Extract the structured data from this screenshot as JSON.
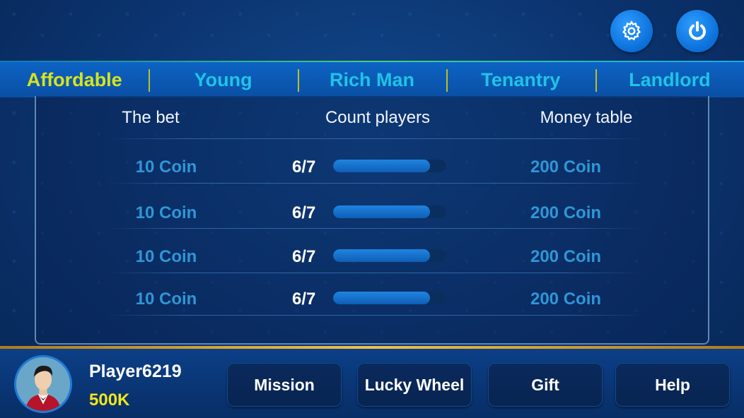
{
  "header": {
    "settings_icon": "gear-icon",
    "power_icon": "power-icon"
  },
  "tabs": [
    {
      "label": "Affordable",
      "active": true
    },
    {
      "label": "Young",
      "active": false
    },
    {
      "label": "Rich Man",
      "active": false
    },
    {
      "label": "Tenantry",
      "active": false
    },
    {
      "label": "Landlord",
      "active": false
    }
  ],
  "table": {
    "columns": [
      "The bet",
      "Count players",
      "Money table"
    ],
    "rows": [
      {
        "bet": "10 Coin",
        "count": "6/7",
        "fill": 0.857,
        "money": "200 Coin"
      },
      {
        "bet": "10 Coin",
        "count": "6/7",
        "fill": 0.857,
        "money": "200 Coin"
      },
      {
        "bet": "10 Coin",
        "count": "6/7",
        "fill": 0.857,
        "money": "200 Coin"
      },
      {
        "bet": "10 Coin",
        "count": "6/7",
        "fill": 0.857,
        "money": "200 Coin"
      }
    ]
  },
  "player": {
    "name": "Player6219",
    "coins": "500K"
  },
  "menu": {
    "mission": "Mission",
    "lucky_wheel": "Lucky Wheel",
    "gift": "Gift",
    "help": "Help"
  },
  "colors": {
    "active_tab": "#d8e31c",
    "inactive_tab": "#1ec4e6",
    "coin_text": "#2f96d6",
    "player_coins": "#f2e619"
  }
}
